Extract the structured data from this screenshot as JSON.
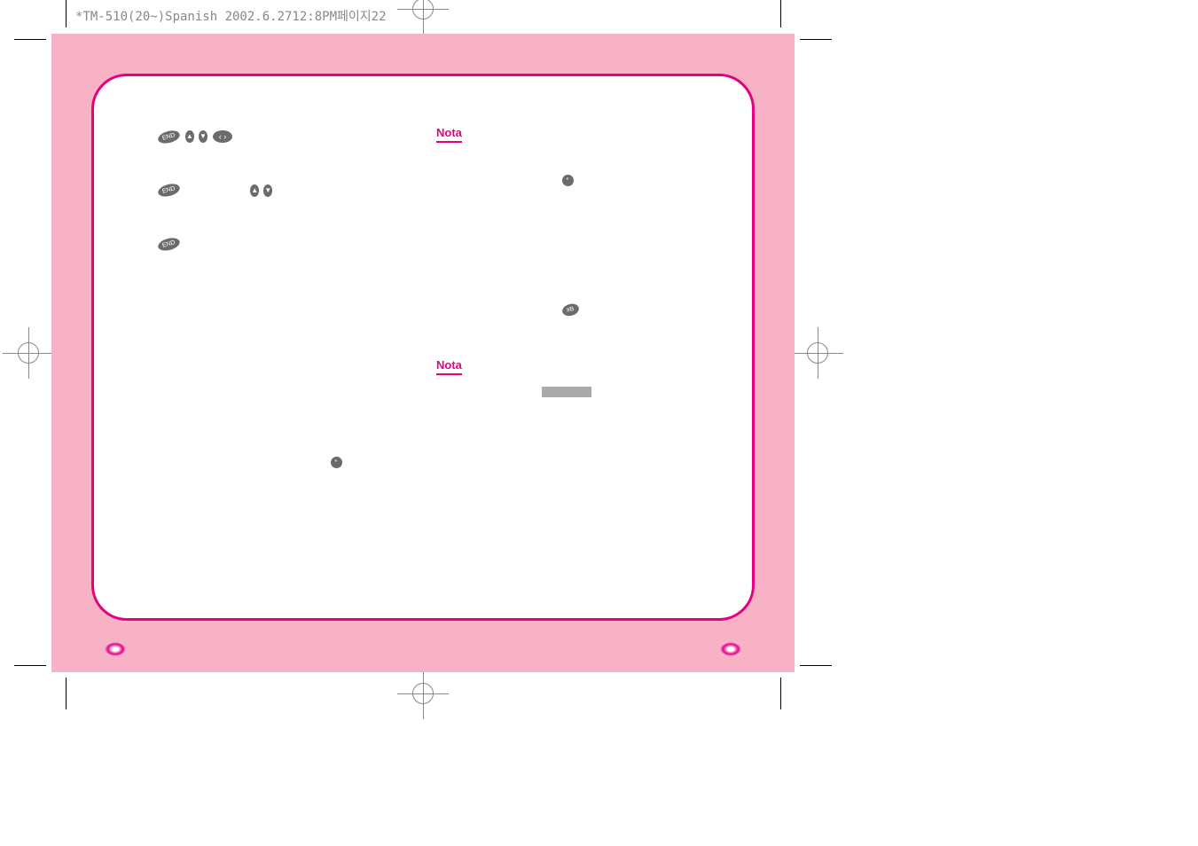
{
  "header": "*TM-510(20~)Spanish 2002.6.2712:8PM페이지22",
  "nota_label": "Nota",
  "icons": {
    "end": "END",
    "up": "▲",
    "down": "▼",
    "star": "*",
    "hash": "#B"
  }
}
